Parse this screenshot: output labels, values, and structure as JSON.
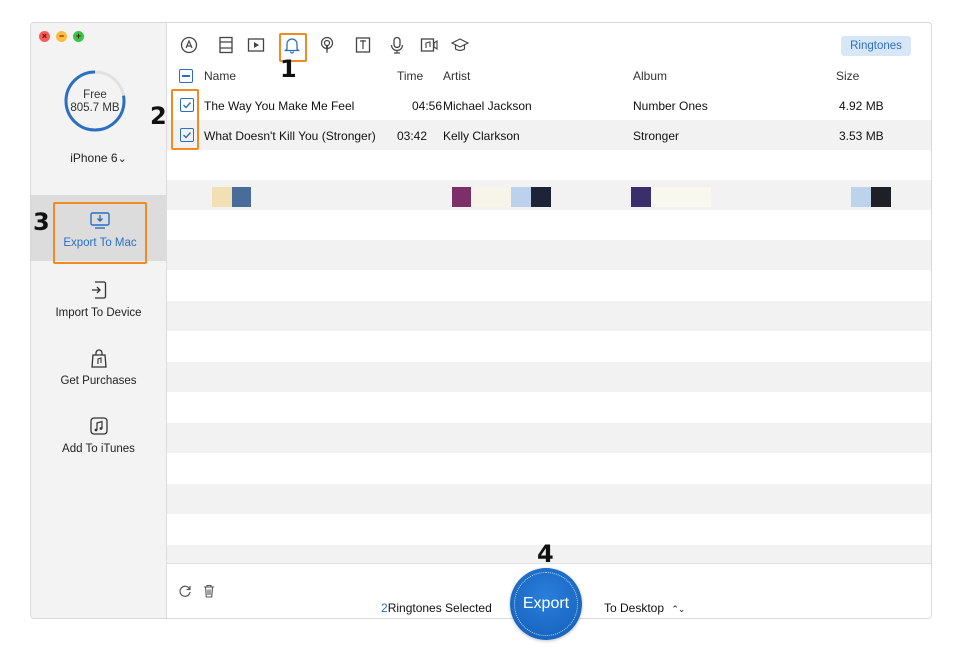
{
  "window_controls": {
    "close": "×",
    "minimize": "−",
    "maximize": "+"
  },
  "sidebar": {
    "storage": {
      "label": "Free",
      "value": "805.7 MB",
      "used_fraction": 0.22
    },
    "device": {
      "name": "iPhone 6",
      "chevron": "⌄"
    },
    "items": [
      {
        "label": "Export To Mac",
        "icon": "export-to-mac-icon",
        "active": true
      },
      {
        "label": "Import To Device",
        "icon": "import-to-device-icon"
      },
      {
        "label": "Get Purchases",
        "icon": "get-purchases-icon"
      },
      {
        "label": "Add To iTunes",
        "icon": "add-to-itunes-icon"
      }
    ]
  },
  "toolbar": {
    "categories": [
      "apps-icon",
      "photos-icon",
      "videos-icon",
      "ringtones-icon",
      "podcasts-icon",
      "books-icon",
      "voice-memos-icon",
      "music-video-icon",
      "itunes-u-icon"
    ],
    "selected": "ringtones-icon",
    "category_button": "Ringtones"
  },
  "table": {
    "columns": [
      "Name",
      "Time",
      "Artist",
      "Album",
      "Size"
    ],
    "rows": [
      {
        "name": "The Way You Make Me Feel",
        "time": "04:56",
        "artist": "Michael Jackson",
        "album": "Number Ones",
        "size": "4.92 MB",
        "checked": true
      },
      {
        "name": "What Doesn't Kill You (Stronger)",
        "time": "03:42",
        "artist": "Kelly Clarkson",
        "album": "Stronger",
        "size": "3.53 MB",
        "checked": true
      }
    ]
  },
  "footer": {
    "selected_count": "2",
    "selected_suffix": "Ringtones Selected",
    "export_label": "Export",
    "destination": "To Desktop",
    "destination_icon": "⌃⌄"
  },
  "annotations": [
    "1",
    "2",
    "3",
    "4"
  ],
  "colors": {
    "accent": "#2b6fc4",
    "highlight": "#f08a24",
    "export": "#1565c0"
  }
}
